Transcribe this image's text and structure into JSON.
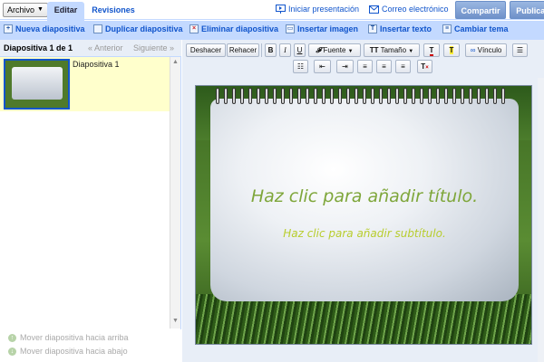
{
  "topbar": {
    "archivo": "Archivo",
    "tabs": [
      {
        "label": "Editar"
      },
      {
        "label": "Revisiones"
      }
    ],
    "iniciar_presentacion": "Iniciar presentación",
    "correo": "Correo electrónico",
    "compartir": "Compartir",
    "publicar": "Publicar"
  },
  "actions": {
    "nueva": "Nueva diapositiva",
    "duplicar": "Duplicar diapositiva",
    "eliminar": "Eliminar diapositiva",
    "insertar_imagen": "Insertar imagen",
    "insertar_texto": "Insertar texto",
    "cambiar_tema": "Cambiar tema"
  },
  "left": {
    "slide_count": "Diapositiva 1 de 1",
    "prev": "« Anterior",
    "next": "Siguiente »",
    "slides": [
      {
        "name": "Diapositiva 1"
      }
    ],
    "mover_arriba": "Mover diapositiva hacia arriba",
    "mover_abajo": "Mover diapositiva hacia abajo"
  },
  "format": {
    "deshacer": "Deshacer",
    "rehacer": "Rehacer",
    "bold": "B",
    "italic": "I",
    "underline": "U",
    "fuente": "Fuente",
    "tamano": "Tamaño",
    "vinculo": "Vínculo"
  },
  "slide": {
    "title_placeholder": "Haz clic para añadir título.",
    "subtitle_placeholder": "Haz clic para añadir subtítulo."
  }
}
